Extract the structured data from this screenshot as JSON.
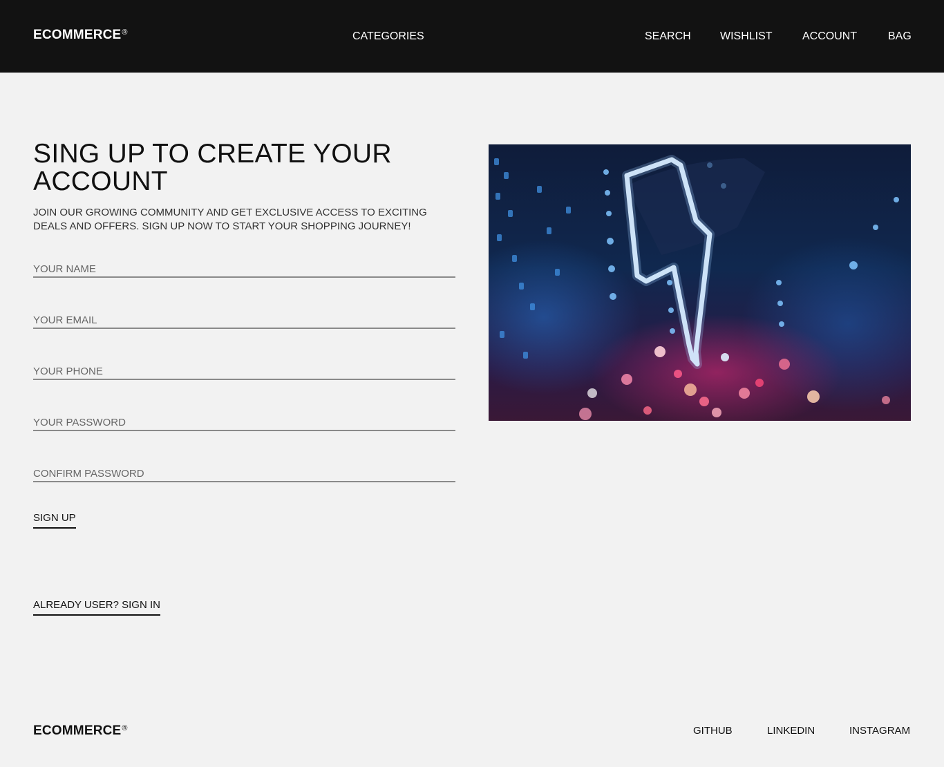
{
  "header": {
    "brand": "ECOMMERCE",
    "brand_mark": "®",
    "nav": {
      "categories": "CATEGORIES",
      "search": "SEARCH",
      "wishlist": "WISHLIST",
      "account": "ACCOUNT",
      "bag": "BAG"
    }
  },
  "main": {
    "title": "SING UP TO CREATE YOUR ACCOUNT",
    "subtitle": "JOIN OUR GROWING COMMUNITY AND GET EXCLUSIVE ACCESS TO EXCITING DEALS AND OFFERS. SIGN UP NOW TO START YOUR SHOPPING JOURNEY!",
    "form": {
      "name_placeholder": "YOUR NAME",
      "email_placeholder": "YOUR EMAIL",
      "phone_placeholder": "YOUR PHONE",
      "password_placeholder": "YOUR PASSWORD",
      "confirm_placeholder": "CONFIRM PASSWORD",
      "submit_label": "SIGN UP"
    },
    "signin_link": "ALREADY USER? SIGN IN"
  },
  "footer": {
    "brand": "ECOMMERCE",
    "brand_mark": "®",
    "links": {
      "github": "GITHUB",
      "linkedin": "LINKEDIN",
      "instagram": "INSTAGRAM"
    }
  },
  "colors": {
    "header_bg": "#121212",
    "page_bg": "#f2f2f2",
    "text": "#111111",
    "field_underline": "#8a8a8a"
  }
}
